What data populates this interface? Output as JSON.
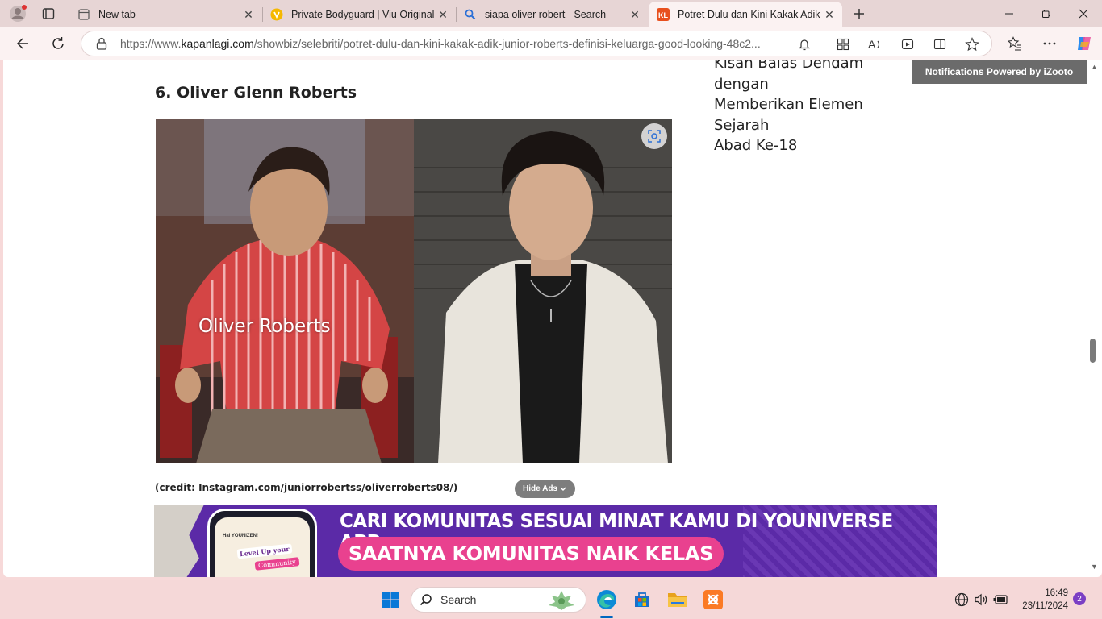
{
  "tabs": [
    {
      "title": "New tab"
    },
    {
      "title": "Private Bodyguard | Viu Original"
    },
    {
      "title": "siapa oliver robert - Search"
    },
    {
      "title": "Potret Dulu dan Kini Kakak Adik Ju",
      "active": true
    }
  ],
  "address": {
    "url_prefix": "https://www.",
    "url_domain": "kapanlagi.com",
    "url_path": "/showbiz/selebriti/potret-dulu-dan-kini-kakak-adik-junior-roberts-definisi-keluarga-good-looking-48c2..."
  },
  "article": {
    "heading": "6. Oliver Glenn Roberts",
    "photo_label": "Oliver Roberts",
    "credit": "(credit: Instagram.com/juniorrobertss/oliverroberts08/)",
    "hide_ads": "Hide Ads"
  },
  "sidebar": {
    "line1": "Kisah Balas Dendam dengan",
    "line2": "Memberikan Elemen Sejarah",
    "line3": "Abad Ke-18"
  },
  "notification": {
    "text": "Notifications Powered by iZooto"
  },
  "banner": {
    "line1": "CARI KOMUNITAS SESUAI MINAT KAMU DI YOUNIVERSE APP",
    "line2": "SAATNYA KOMUNITAS NAIK KELAS",
    "phone_greeting": "Hai YOUNIZEN!",
    "phone_headline1": "Level Up your",
    "phone_headline2": "Community"
  },
  "taskbar": {
    "search_label": "Search",
    "time": "16:49",
    "date": "23/11/2024",
    "notification_count": "2"
  },
  "colors": {
    "accent": "#0067c0",
    "banner_purple": "#5b2aa7",
    "banner_pink": "#e9418f"
  }
}
